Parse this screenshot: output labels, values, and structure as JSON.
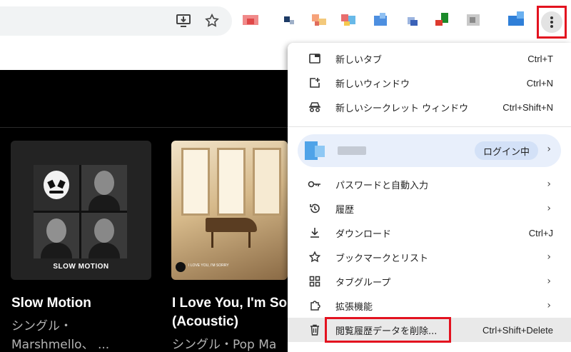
{
  "menu": {
    "items": [
      {
        "label": "新しいタブ",
        "shortcut": "Ctrl+T",
        "icon": "new-tab-icon"
      },
      {
        "label": "新しいウィンドウ",
        "shortcut": "Ctrl+N",
        "icon": "new-window-icon"
      },
      {
        "label": "新しいシークレット ウィンドウ",
        "shortcut": "Ctrl+Shift+N",
        "icon": "incognito-icon"
      }
    ],
    "profile": {
      "badge": "ログイン中"
    },
    "sub_items": [
      {
        "label": "パスワードと自動入力",
        "icon": "key-icon",
        "arrow": "›"
      },
      {
        "label": "履歴",
        "icon": "history-icon",
        "arrow": "›"
      },
      {
        "label": "ダウンロード",
        "icon": "download-icon",
        "shortcut": "Ctrl+J"
      },
      {
        "label": "ブックマークとリスト",
        "icon": "star-icon",
        "arrow": "›"
      },
      {
        "label": "タブグループ",
        "icon": "tab-groups-icon",
        "arrow": "›"
      },
      {
        "label": "拡張機能",
        "icon": "extensions-icon",
        "arrow": "›"
      },
      {
        "label": "閲覧履歴データを削除...",
        "icon": "trash-icon",
        "shortcut": "Ctrl+Shift+Delete"
      }
    ]
  },
  "page": {
    "cards": [
      {
        "title": "Slow Motion",
        "sub1": "シングル・",
        "sub2": "Marshmello、 ...",
        "art_text": "SLOW MOTION"
      },
      {
        "title": "I Love You, I'm Sor",
        "title2": "(Acoustic)",
        "sub1": "シングル・Pop Ma",
        "art_text": "I LOVE YOU, I'M SORRY"
      }
    ]
  },
  "colors": {
    "highlight": "#e3121f",
    "accent": "#1a73e8"
  }
}
